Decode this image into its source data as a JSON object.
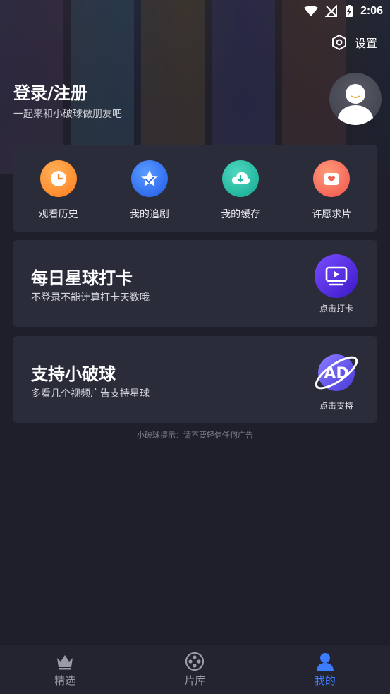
{
  "status_bar": {
    "time": "2:06"
  },
  "header": {
    "settings_label": "设置",
    "login_title": "登录/注册",
    "login_subtitle": "一起来和小破球做朋友吧"
  },
  "quick_actions": [
    {
      "label": "观看历史",
      "icon": "clock-icon",
      "color": "#ff8a2a"
    },
    {
      "label": "我的追剧",
      "icon": "star-icon",
      "color": "#2f6cf5"
    },
    {
      "label": "我的缓存",
      "icon": "cloud-download-icon",
      "color": "#1fb8a0"
    },
    {
      "label": "许愿求片",
      "icon": "gift-box-icon",
      "color": "#ff6a5a"
    }
  ],
  "checkin": {
    "title": "每日星球打卡",
    "subtitle": "不登录不能计算打卡天数哦",
    "button_label": "点击打卡"
  },
  "support": {
    "title": "支持小破球",
    "subtitle": "多看几个视频广告支持星球",
    "button_label": "点击支持",
    "badge_text": "AD"
  },
  "tip": "小破球提示：请不要轻信任何广告",
  "tabs": [
    {
      "label": "精选",
      "icon": "crown-icon",
      "active": false
    },
    {
      "label": "片库",
      "icon": "film-reel-icon",
      "active": false
    },
    {
      "label": "我的",
      "icon": "person-icon",
      "active": true
    }
  ],
  "colors": {
    "accent": "#3d7cff",
    "background": "#1e1f2b",
    "card": "#2a2c39"
  }
}
